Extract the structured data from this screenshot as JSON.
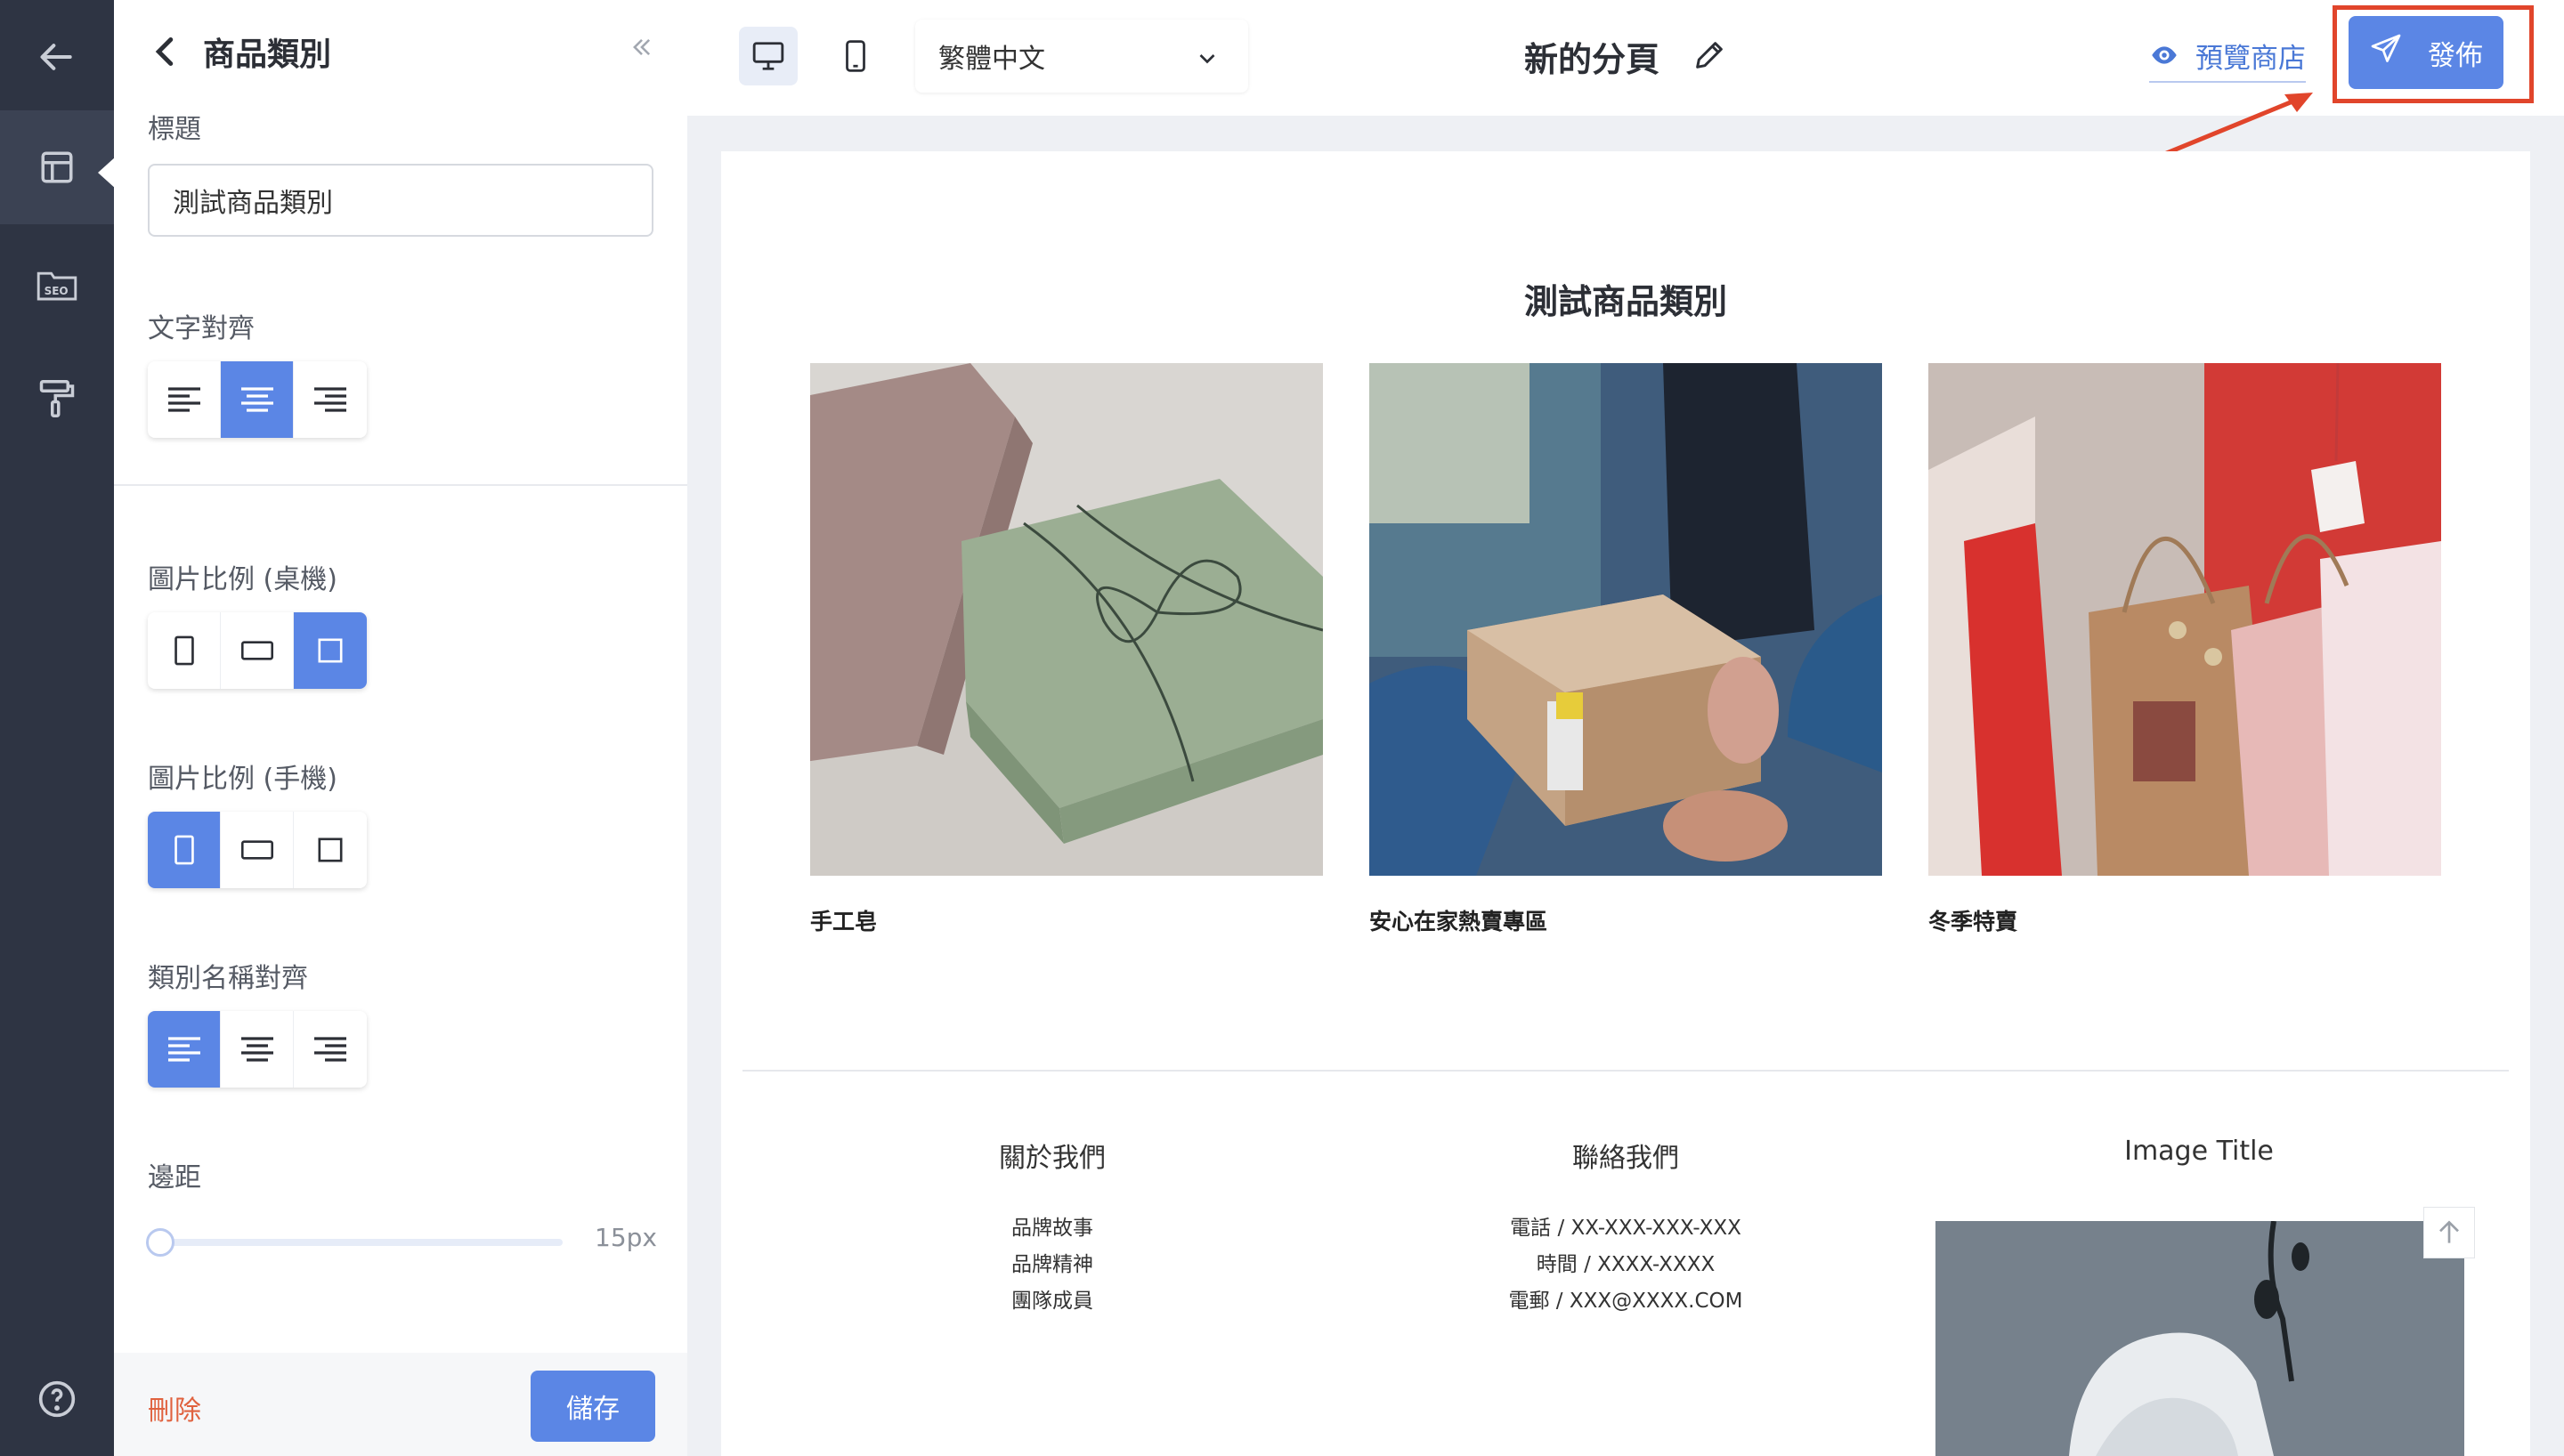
{
  "panel": {
    "title": "商品類別",
    "title_label": "標題",
    "title_value": "測試商品類別",
    "text_align_label": "文字對齊",
    "ratio_desktop_label": "圖片比例 (桌機)",
    "ratio_mobile_label": "圖片比例 (手機)",
    "name_align_label": "類別名稱對齊",
    "padding_label": "邊距",
    "padding_value": "15px",
    "padding_level": 0.0,
    "delete_label": "刪除",
    "save_label": "儲存"
  },
  "topbar": {
    "language": "繁體中文",
    "page_name": "新的分頁",
    "preview_label": "預覽商店",
    "publish_label": "發佈"
  },
  "preview": {
    "section_title": "測試商品類別",
    "categories": [
      {
        "name": "手工皂"
      },
      {
        "name": "安心在家熱賣專區"
      },
      {
        "name": "冬季特賣"
      }
    ],
    "footer": {
      "about": {
        "heading": "關於我們",
        "links": [
          "品牌故事",
          "品牌精神",
          "團隊成員"
        ]
      },
      "contact": {
        "heading": "聯絡我們",
        "lines": [
          "電話 / XX-XXX-XXX-XXX",
          "時間 / XXXX-XXXX",
          "電郵 / XXX@XXXX.COM"
        ]
      },
      "image": {
        "heading": "Image Title"
      }
    }
  },
  "colors": {
    "rail": "#2e3443",
    "accent": "#5b86e5",
    "danger": "#e0623f",
    "highlight": "#e1452b"
  }
}
